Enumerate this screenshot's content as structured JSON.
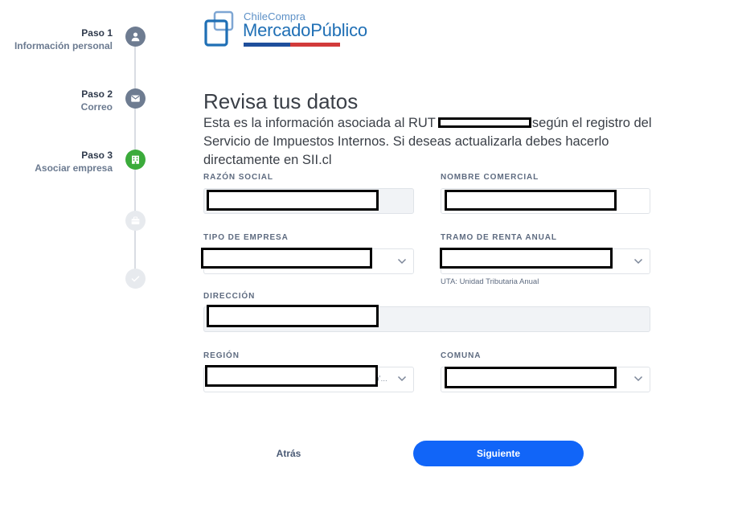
{
  "stepper": {
    "steps": [
      {
        "num": "Paso 1",
        "label": "Información personal",
        "icon": "user-icon",
        "state": "done"
      },
      {
        "num": "Paso 2",
        "label": "Correo",
        "icon": "mail-icon",
        "state": "done"
      },
      {
        "num": "Paso 3",
        "label": "Asociar empresa",
        "icon": "building-icon",
        "state": "active"
      },
      {
        "num": "",
        "label": "",
        "icon": "briefcase-icon",
        "state": "pending"
      },
      {
        "num": "",
        "label": "",
        "icon": "check-icon",
        "state": "pending"
      }
    ]
  },
  "logo": {
    "small": "ChileCompra",
    "big": "MercadoPúblico",
    "colors": {
      "blue": "#1f6fb5",
      "light_blue": "#5b8fc6",
      "red": "#d23a3a"
    }
  },
  "heading": {
    "title": "Revisa tus datos",
    "desc_before": "Esta es la información asociada al RUT",
    "desc_after": "según el registro del Servicio de Impuestos Internos. Si deseas actualizarla debes hacerlo directamente en SII.cl"
  },
  "form": {
    "razon_social": {
      "label": "RAZÓN SOCIAL"
    },
    "nombre_comercial": {
      "label": "NOMBRE COMERCIAL"
    },
    "tipo_empresa": {
      "label": "TIPO DE EMPRESA"
    },
    "tramo_renta": {
      "label": "TRAMO DE RENTA ANUAL",
      "hint": "UTA: Unidad Tributaria Anual"
    },
    "direccion": {
      "label": "DIRECCIÓN"
    },
    "region": {
      "label": "REGIÓN",
      "truncated": "o'..."
    },
    "comuna": {
      "label": "COMUNA"
    }
  },
  "buttons": {
    "back": "Atrás",
    "next": "Siguiente"
  },
  "colors": {
    "primary": "#1165f8",
    "step_done": "#6e7c91",
    "step_active": "#3bab3b",
    "step_pending": "#e7eaee"
  }
}
